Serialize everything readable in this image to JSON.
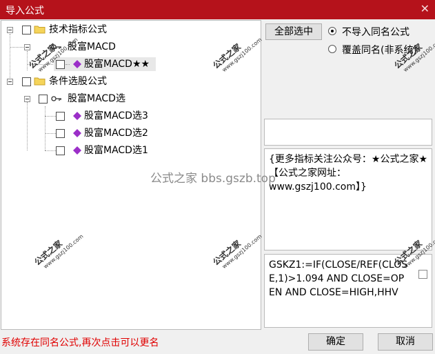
{
  "window": {
    "title": "导入公式",
    "close_glyph": "✕"
  },
  "tree": {
    "root1": {
      "label": "技术指标公式",
      "child": {
        "label": "股富MACD",
        "leaf": "股富MACD★★"
      }
    },
    "root2": {
      "label": "条件选股公式",
      "child": {
        "label": "股富MACD选",
        "leaves": [
          "股富MACD选3",
          "股富MACD选2",
          "股富MACD选1"
        ]
      }
    }
  },
  "controls": {
    "select_all": "全部选中",
    "radio_skip": "不导入同名公式",
    "radio_overwrite": "覆盖同名(非系统)"
  },
  "panels": {
    "description": "{更多指标关注公众号：★公式之家★ 【公式之家网址：www.gszj100.com】}",
    "code": "GSKZ1:=IF(CLOSE/REF(CLOSE,1)>1.094 AND CLOSE=OPEN AND CLOSE=HIGH,HHV"
  },
  "status": "系统存在同名公式,再次点击可以更名",
  "buttons": {
    "ok": "确定",
    "cancel": "取消"
  },
  "watermark": {
    "brand": "公式之家",
    "url": "www.gszj100.com",
    "center": "公式之家 bbs.gszb.top"
  },
  "colors": {
    "titlebar": "#b5121b",
    "status": "#e00000",
    "item_icon": "#9b2fc8"
  }
}
